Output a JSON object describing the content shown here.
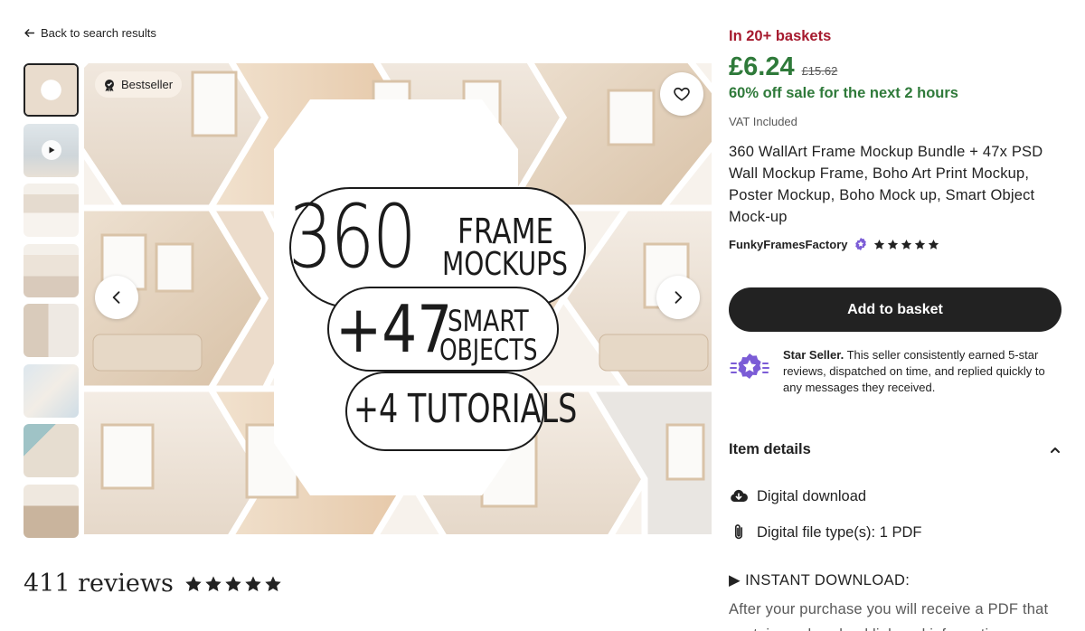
{
  "nav": {
    "back_label": "Back to search results"
  },
  "gallery": {
    "badge": "Bestseller",
    "headline": {
      "big_number": "360",
      "line1a": "FRAME",
      "line1b": "MOCKUPS",
      "line2_number": "+47",
      "line2a": "SMART",
      "line2b": "OBJECTS",
      "line3": "+4 TUTORIALS"
    }
  },
  "reviews": {
    "count_label": "411 reviews",
    "rating": 5
  },
  "listing": {
    "baskets": "In 20+ baskets",
    "price": "£6.24",
    "old_price": "£15.62",
    "sale": "60% off sale for the next 2 hours",
    "vat": "VAT Included",
    "title": "360 WallArt Frame Mockup Bundle + 47x PSD Wall Mockup Frame, Boho Art Print Mockup, Poster Mockup, Boho Mock up, Smart Object Mock-up",
    "seller": "FunkyFramesFactory",
    "seller_rating": 5,
    "add_to_basket": "Add to basket",
    "star_seller_title": "Star Seller.",
    "star_seller_text": " This seller consistently earned 5-star reviews, dispatched on time, and replied quickly to any messages they received.",
    "item_details_label": "Item details",
    "detail_download": "Digital download",
    "detail_filetype": "Digital file type(s): 1 PDF",
    "desc_head": "▶ INSTANT DOWNLOAD:",
    "desc_body": "After your purchase you will receive a PDF that contains a download link and informations"
  },
  "colors": {
    "price_green": "#2f7a3a",
    "basket_red": "#a61a2e",
    "button_dark": "#222222",
    "star_seller_purple": "#7b5cd6"
  }
}
